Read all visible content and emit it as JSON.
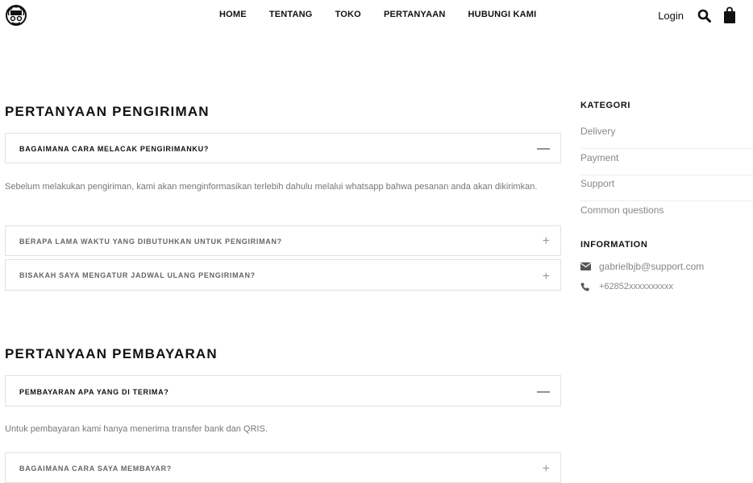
{
  "header": {
    "logo_text": "OHM CLOUD",
    "nav": [
      "HOME",
      "TENTANG",
      "TOKO",
      "PERTANYAAN",
      "HUBUNGI KAMI"
    ],
    "login": "Login",
    "icons": [
      "search-icon",
      "shopping-bag-icon"
    ]
  },
  "shipping": {
    "title": "PERTANYAAN PENGIRIMAN",
    "items": [
      {
        "question": "BAGAIMANA CARA MELACAK PENGIRIMANKU?",
        "state": "open",
        "sign": "—",
        "answer": "Sebelum melakukan pengiriman, kami akan menginformasikan terlebih dahulu melalui whatsapp bahwa pesanan anda akan dikirimkan."
      },
      {
        "question": "BERAPA LAMA WAKTU YANG DIBUTUHKAN UNTUK PENGIRIMAN?",
        "state": "closed",
        "sign": "+"
      },
      {
        "question": "BISAKAH SAYA MENGATUR JADWAL ULANG PENGIRIMAN?",
        "state": "closed",
        "sign": "+"
      }
    ]
  },
  "payment": {
    "title": "PERTANYAAN PEMBAYARAN",
    "items": [
      {
        "question": "PEMBAYARAN APA YANG DI TERIMA?",
        "state": "open",
        "sign": "—",
        "answer": "Untuk pembayaran kami hanya menerima transfer bank dan QRIS."
      },
      {
        "question": "BAGAIMANA CARA SAYA MEMBAYAR?",
        "state": "closed",
        "sign": "+"
      }
    ]
  },
  "sidebar": {
    "category_title": "KATEGORI",
    "categories": [
      "Delivery",
      "Payment",
      "Support",
      "Common questions"
    ],
    "info_title": "INFORMATION",
    "email": "gabrielbjb@support.com",
    "phone": "+62852xxxxxxxxxx"
  }
}
